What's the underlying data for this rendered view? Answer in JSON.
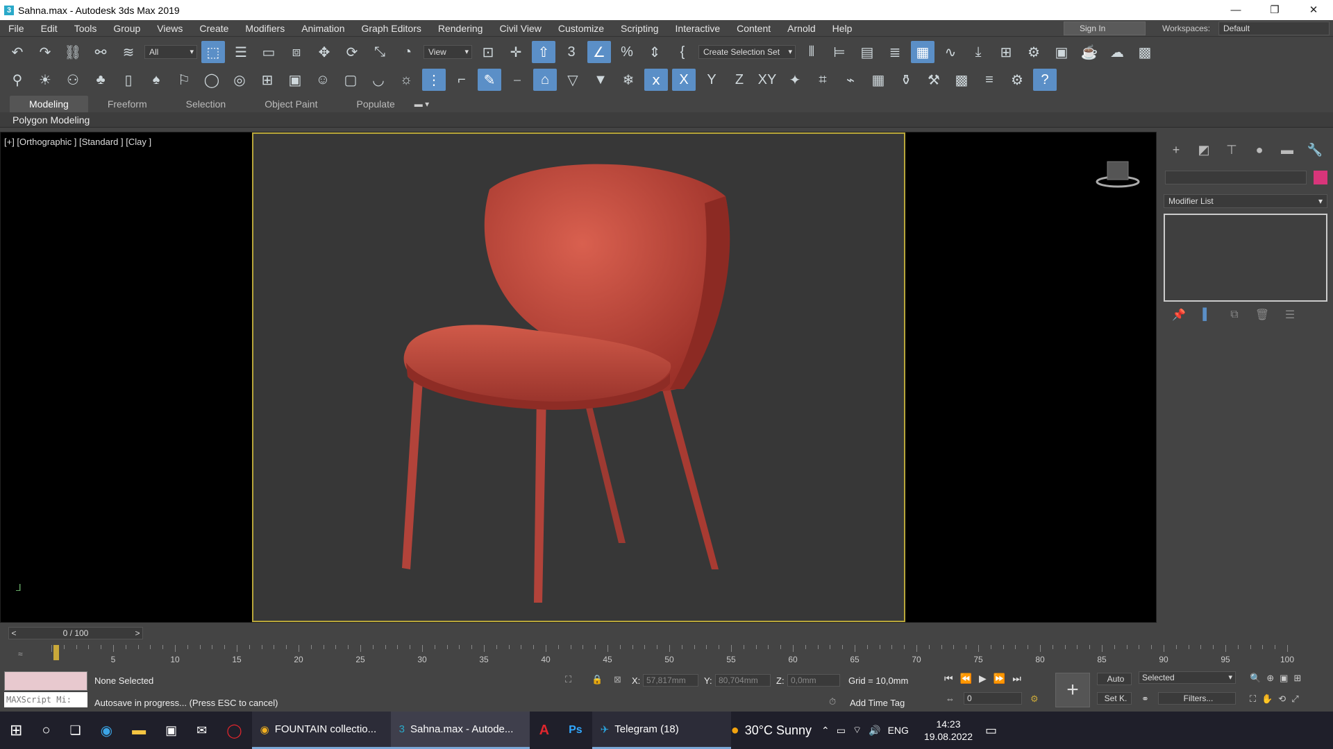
{
  "window": {
    "title": "Sahna.max - Autodesk 3ds Max 2019",
    "app_icon": "3"
  },
  "menu": [
    "File",
    "Edit",
    "Tools",
    "Group",
    "Views",
    "Create",
    "Modifiers",
    "Animation",
    "Graph Editors",
    "Rendering",
    "Civil View",
    "Customize",
    "Scripting",
    "Interactive",
    "Content",
    "Arnold",
    "Help"
  ],
  "signin_label": "Sign In",
  "workspaces_label": "Workspaces:",
  "workspace_value": "Default",
  "toolbar1": {
    "filter_value": "All",
    "view_value": "View",
    "selection_set": "Create Selection Set"
  },
  "ribbon_tabs": [
    "Modeling",
    "Freeform",
    "Selection",
    "Object Paint",
    "Populate"
  ],
  "ribbon_active": "Modeling",
  "polybar_label": "Polygon Modeling",
  "viewport_label": "[+] [Orthographic ] [Standard ] [Clay ]",
  "chair_color": "#c0463b",
  "command_panel": {
    "modifier_list": "Modifier List",
    "color": "#d8357a"
  },
  "timeline": {
    "counter": "0 / 100",
    "prev": "<",
    "next": ">",
    "ticks": [
      "5",
      "10",
      "15",
      "20",
      "25",
      "30",
      "35",
      "40",
      "45",
      "50",
      "55",
      "60",
      "65",
      "70",
      "75",
      "80",
      "85",
      "90",
      "95",
      "100"
    ]
  },
  "status": {
    "selection": "None Selected",
    "prompt": "Autosave in progress... (Press ESC to cancel)",
    "maxscript": "MAXScript Mi:",
    "x_label": "X:",
    "x_value": "57,817mm",
    "y_label": "Y:",
    "y_value": "80,704mm",
    "z_label": "Z:",
    "z_value": "0,0mm",
    "grid": "Grid = 10,0mm",
    "add_time_tag": "Add Time Tag",
    "auto": "Auto",
    "set_key": "Set K.",
    "key_mode": "Selected",
    "filters": "Filters...",
    "frame": "0"
  },
  "taskbar": {
    "apps": [
      {
        "name": "chrome",
        "label": "FOUNTAIN collectio..."
      },
      {
        "name": "3dsmax",
        "label": "Sahna.max - Autode..."
      },
      {
        "name": "telegram",
        "label": "Telegram (18)"
      }
    ],
    "weather": "30°C  Sunny",
    "lang": "ENG",
    "time": "14:23",
    "date": "19.08.2022"
  }
}
